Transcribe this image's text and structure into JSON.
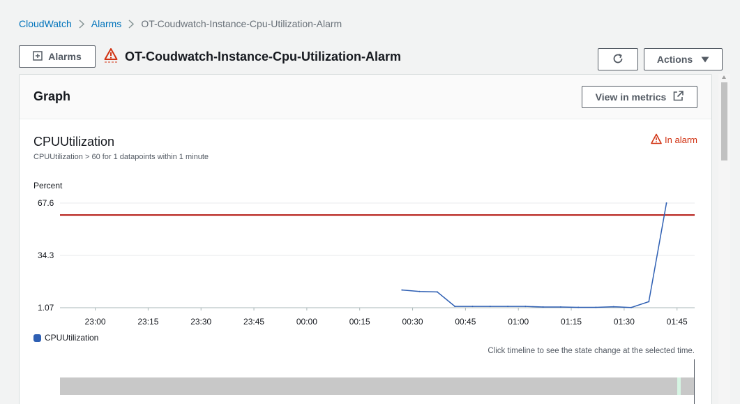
{
  "breadcrumb": {
    "items": [
      "CloudWatch",
      "Alarms",
      "OT-Coudwatch-Instance-Cpu-Utilization-Alarm"
    ]
  },
  "header": {
    "back_button_label": "Alarms",
    "title": "OT-Coudwatch-Instance-Cpu-Utilization-Alarm",
    "actions_label": "Actions"
  },
  "graph_panel": {
    "title": "Graph",
    "view_metrics_label": "View in metrics",
    "metric_name": "CPUUtilization",
    "condition": "CPUUtilization > 60 for 1 datapoints within 1 minute",
    "state": "In alarm",
    "unit": "Percent",
    "timeline_hint": "Click timeline to see the state change at the selected time."
  },
  "colors": {
    "link": "#0073bb",
    "alarm": "#d13212",
    "series": "#2e5fb3",
    "threshold": "#b3140f"
  },
  "chart_data": {
    "type": "line",
    "ylabel": "Percent",
    "yticks": [
      "67.6",
      "34.3",
      "1.07"
    ],
    "ylim": [
      1.07,
      67.6
    ],
    "x_tick_labels": [
      "23:00",
      "23:15",
      "23:30",
      "23:45",
      "00:00",
      "00:15",
      "00:30",
      "00:45",
      "01:00",
      "01:15",
      "01:30",
      "01:45"
    ],
    "x_range_minutes": [
      -70,
      110
    ],
    "threshold": 60,
    "series": [
      {
        "name": "CPUUtilization",
        "x": [
          "00:27",
          "00:32",
          "00:37",
          "00:42",
          "00:47",
          "00:52",
          "00:57",
          "01:02",
          "01:07",
          "01:12",
          "01:17",
          "01:22",
          "01:27",
          "01:32",
          "01:37",
          "01:42"
        ],
        "x_minutes": [
          27,
          32,
          37,
          42,
          47,
          52,
          57,
          62,
          67,
          72,
          77,
          82,
          87,
          92,
          97,
          102
        ],
        "values": [
          12.3,
          11.4,
          11.1,
          1.9,
          1.9,
          1.9,
          1.9,
          1.9,
          1.5,
          1.5,
          1.3,
          1.3,
          1.7,
          1.2,
          4.9,
          67.6
        ]
      }
    ],
    "legend": [
      "CPUUtilization"
    ],
    "legend_position": "bottom-left"
  }
}
